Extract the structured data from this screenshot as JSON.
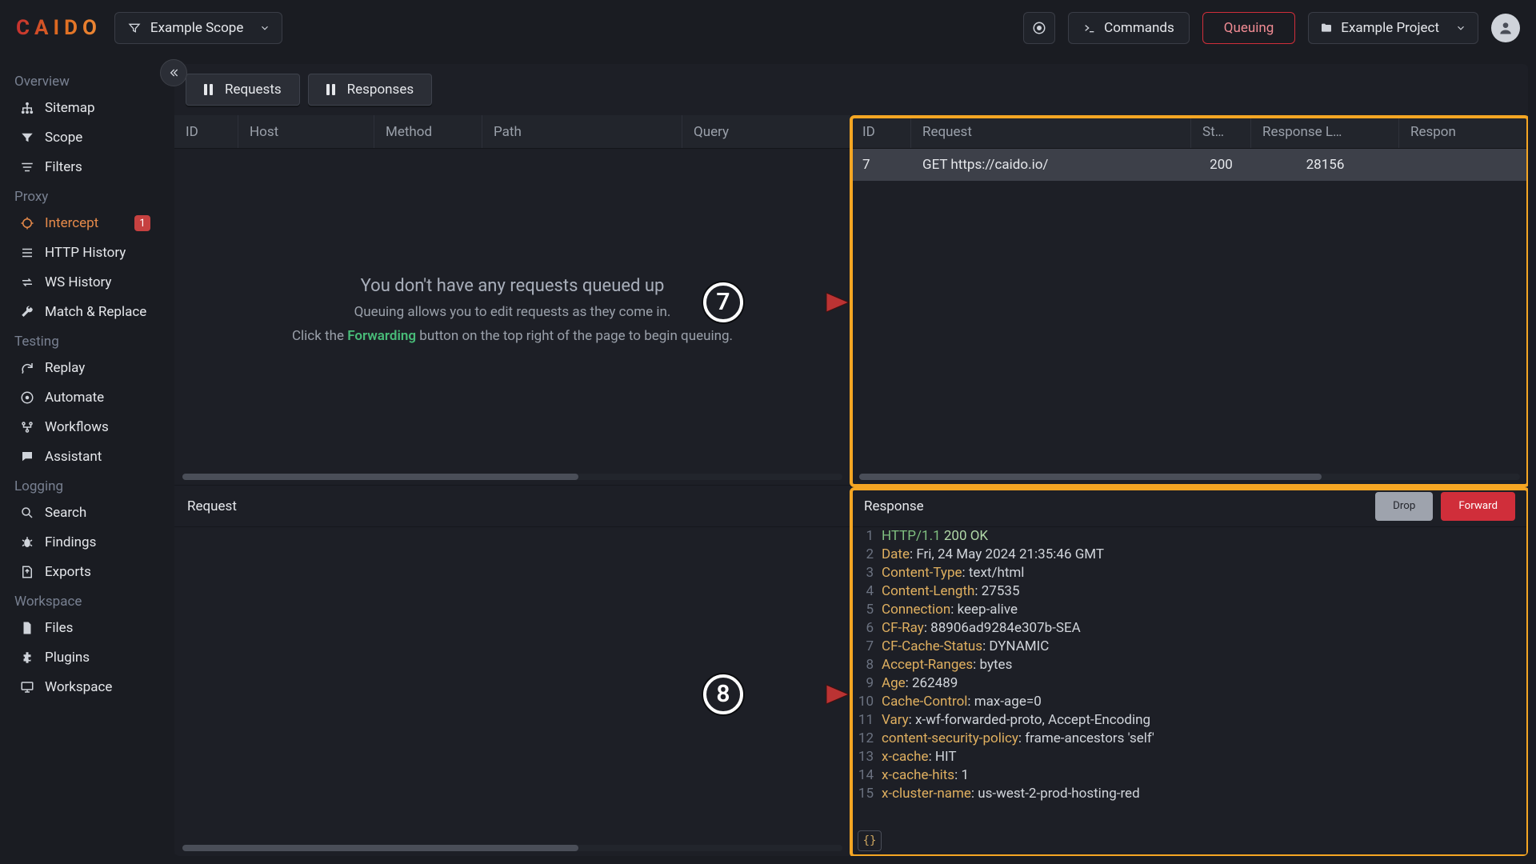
{
  "brand": "CAIDO",
  "topbar": {
    "scope_label": "Example Scope",
    "commands_label": "Commands",
    "queuing_label": "Queuing",
    "project_label": "Example Project"
  },
  "sidebar": {
    "sections": [
      {
        "label": "Overview",
        "items": [
          {
            "icon": "sitemap",
            "label": "Sitemap"
          },
          {
            "icon": "filter",
            "label": "Scope"
          },
          {
            "icon": "lines",
            "label": "Filters"
          }
        ]
      },
      {
        "label": "Proxy",
        "items": [
          {
            "icon": "target",
            "label": "Intercept",
            "active": true,
            "badge": "1"
          },
          {
            "icon": "list",
            "label": "HTTP History"
          },
          {
            "icon": "swap",
            "label": "WS History"
          },
          {
            "icon": "wrench",
            "label": "Match & Replace"
          }
        ]
      },
      {
        "label": "Testing",
        "items": [
          {
            "icon": "replay",
            "label": "Replay"
          },
          {
            "icon": "automate",
            "label": "Automate"
          },
          {
            "icon": "flow",
            "label": "Workflows"
          },
          {
            "icon": "chat",
            "label": "Assistant"
          }
        ]
      },
      {
        "label": "Logging",
        "items": [
          {
            "icon": "search",
            "label": "Search"
          },
          {
            "icon": "bug",
            "label": "Findings"
          },
          {
            "icon": "export",
            "label": "Exports"
          }
        ]
      },
      {
        "label": "Workspace",
        "items": [
          {
            "icon": "file",
            "label": "Files"
          },
          {
            "icon": "plugin",
            "label": "Plugins"
          },
          {
            "icon": "monitor",
            "label": "Workspace"
          }
        ]
      }
    ]
  },
  "toolbar": {
    "requests_label": "Requests",
    "responses_label": "Responses"
  },
  "left_table": {
    "headers": [
      "ID",
      "Host",
      "Method",
      "Path",
      "Query"
    ]
  },
  "empty": {
    "title": "You don't have any requests queued up",
    "line1": "Queuing allows you to edit requests as they come in.",
    "line2_pre": "Click the ",
    "line2_kw": "Forwarding",
    "line2_post": " button on the top right of the page to begin queuing."
  },
  "right_table": {
    "headers": [
      "ID",
      "Request",
      "St…",
      "Response L…",
      "Respon"
    ],
    "row": {
      "id": "7",
      "request": "GET https://caido.io/",
      "status": "200",
      "len": "28156"
    }
  },
  "request_panel": {
    "title": "Request"
  },
  "response_panel": {
    "title": "Response",
    "drop": "Drop",
    "forward": "Forward",
    "lines": [
      {
        "n": "1",
        "proto": "HTTP/1.1",
        "status": "200 OK"
      },
      {
        "n": "2",
        "h": "Date",
        "v": "Fri, 24 May 2024 21:35:46 GMT"
      },
      {
        "n": "3",
        "h": "Content-Type",
        "v": "text/html"
      },
      {
        "n": "4",
        "h": "Content-Length",
        "v": "27535"
      },
      {
        "n": "5",
        "h": "Connection",
        "v": "keep-alive"
      },
      {
        "n": "6",
        "h": "CF-Ray",
        "v": "88906ad9284e307b-SEA"
      },
      {
        "n": "7",
        "h": "CF-Cache-Status",
        "v": "DYNAMIC"
      },
      {
        "n": "8",
        "h": "Accept-Ranges",
        "v": "bytes"
      },
      {
        "n": "9",
        "h": "Age",
        "v": "262489"
      },
      {
        "n": "10",
        "h": "Cache-Control",
        "v": "max-age=0"
      },
      {
        "n": "11",
        "h": "Vary",
        "v": "x-wf-forwarded-proto, Accept-Encoding"
      },
      {
        "n": "12",
        "h": "content-security-policy",
        "v": "frame-ancestors 'self'"
      },
      {
        "n": "13",
        "h": "x-cache",
        "v": "HIT"
      },
      {
        "n": "14",
        "h": "x-cache-hits",
        "v": "1"
      },
      {
        "n": "15",
        "h": "x-cluster-name",
        "v": "us-west-2-prod-hosting-red"
      }
    ],
    "braces": "{}"
  },
  "callouts": {
    "seven": "7",
    "eight": "8"
  }
}
